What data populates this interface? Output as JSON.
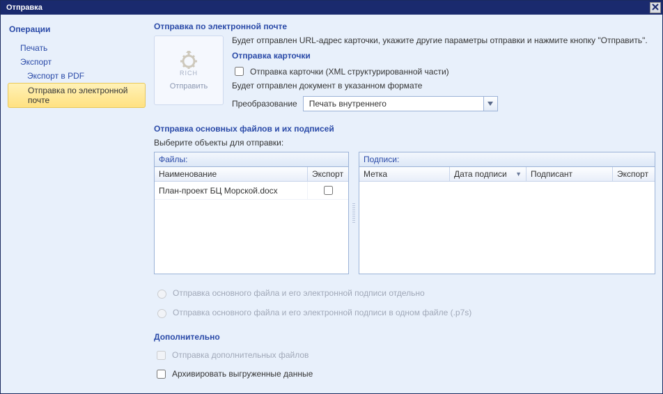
{
  "window": {
    "title": "Отправка"
  },
  "sidebar": {
    "heading": "Операции",
    "items": [
      {
        "label": "Печать",
        "level": "level1",
        "active": false
      },
      {
        "label": "Экспорт",
        "level": "level1",
        "active": false
      },
      {
        "label": "Экспорт в PDF",
        "level": "level2",
        "active": false
      },
      {
        "label": "Отправка по электронной почте",
        "level": "level2",
        "active": true
      }
    ]
  },
  "main": {
    "title": "Отправка по электронной почте",
    "send_button": {
      "rich": "RICH",
      "label": "Отправить"
    },
    "info_text": "Будет отправлен URL-адрес карточки, укажите другие параметры отправки и нажмите кнопку \"Отправить\".",
    "card_heading": "Отправка карточки",
    "card_checkbox": "Отправка карточки (XML структурированной части)",
    "doc_sent_text": "Будет отправлен документ в указанном формате",
    "transform_label": "Преобразование",
    "transform_value": "Печать внутреннего",
    "files_heading": "Отправка основных файлов и их подписей",
    "files_subtext": "Выберите объекты для отправки:",
    "files_panel": {
      "title": "Файлы:",
      "columns": {
        "name": "Наименование",
        "export": "Экспорт"
      },
      "rows": [
        {
          "name": "План-проект БЦ Морской.docx",
          "export": false
        }
      ]
    },
    "sigs_panel": {
      "title": "Подписи:",
      "columns": {
        "label": "Метка",
        "date": "Дата подписи",
        "signer": "Подписант",
        "export": "Экспорт"
      }
    },
    "radio1": "Отправка основного файла и его электронной подписи отдельно",
    "radio2": "Отправка основного файла и его электронной подписи в одном файле (.p7s)",
    "extra_heading": "Дополнительно",
    "extra_cb1": "Отправка дополнительных файлов",
    "extra_cb2": "Архивировать выгруженные данные"
  }
}
